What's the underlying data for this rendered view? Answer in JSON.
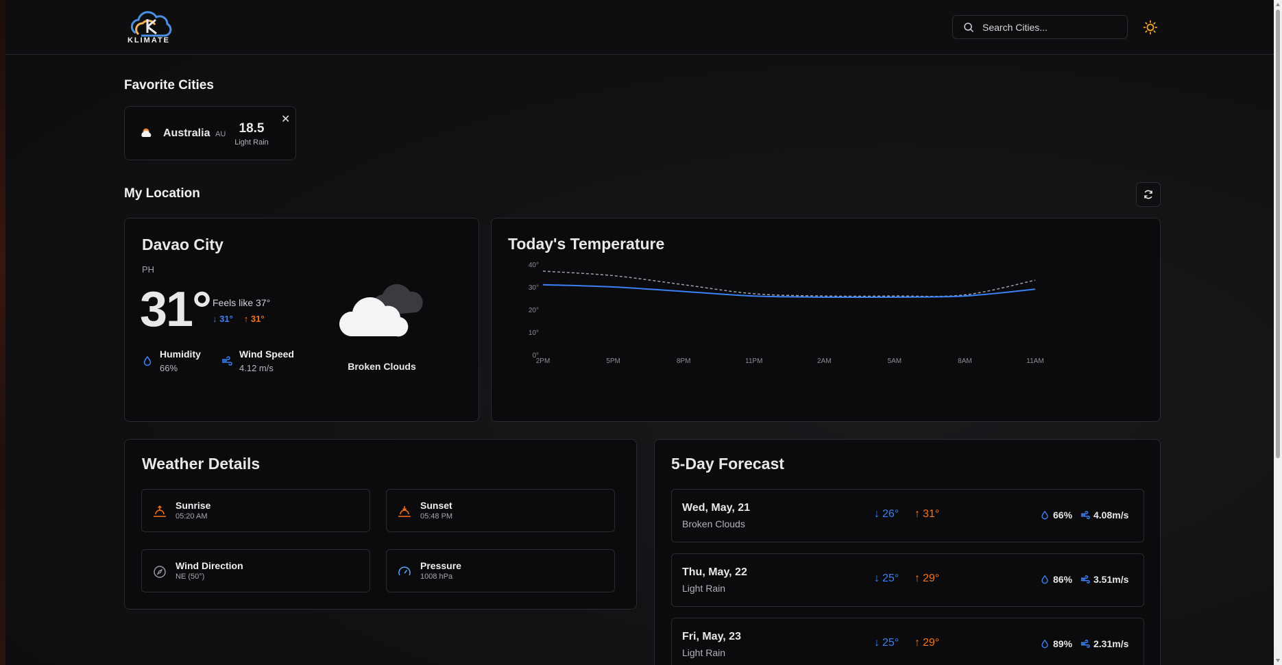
{
  "header": {
    "logo_text": "KLIMATE",
    "search_placeholder": "Search Cities..."
  },
  "favorites": {
    "title": "Favorite Cities",
    "items": [
      {
        "city": "Australia",
        "country": "AU",
        "temp": "18.5",
        "desc": "Light Rain"
      }
    ]
  },
  "location": {
    "title": "My Location",
    "city": "Davao City",
    "country": "PH",
    "temp": "31°",
    "feels_like": "Feels like 37°",
    "low": "31°",
    "high": "31°",
    "humidity_label": "Humidity",
    "humidity_value": "66%",
    "wind_label": "Wind Speed",
    "wind_value": "4.12 m/s",
    "condition": "Broken Clouds"
  },
  "chart_data": {
    "type": "line",
    "title": "Today's Temperature",
    "x": [
      "2PM",
      "5PM",
      "8PM",
      "11PM",
      "2AM",
      "5AM",
      "8AM",
      "11AM"
    ],
    "ylim": [
      0,
      40
    ],
    "yticks": [
      "0°",
      "10°",
      "20°",
      "30°",
      "40°"
    ],
    "series": [
      {
        "values": [
          31,
          30,
          28,
          26,
          25.5,
          25.5,
          26,
          29
        ],
        "color": "#3b82f6",
        "style": "solid"
      },
      {
        "values": [
          37,
          35,
          31,
          27,
          26,
          26,
          26.5,
          33
        ],
        "color": "#9ca3af",
        "style": "dashed"
      }
    ],
    "grid": false
  },
  "details": {
    "title": "Weather Details",
    "items": [
      {
        "label": "Sunrise",
        "value": "05:20 AM",
        "icon": "sunrise-icon"
      },
      {
        "label": "Sunset",
        "value": "05:48 PM",
        "icon": "sunset-icon"
      },
      {
        "label": "Wind Direction",
        "value": "NE (50°)",
        "icon": "compass-icon"
      },
      {
        "label": "Pressure",
        "value": "1008 hPa",
        "icon": "gauge-icon"
      }
    ]
  },
  "forecast": {
    "title": "5-Day Forecast",
    "days": [
      {
        "date": "Wed, May, 21",
        "desc": "Broken Clouds",
        "low": "26°",
        "high": "31°",
        "humidity": "66%",
        "wind": "4.08m/s"
      },
      {
        "date": "Thu, May, 22",
        "desc": "Light Rain",
        "low": "25°",
        "high": "29°",
        "humidity": "86%",
        "wind": "3.51m/s"
      },
      {
        "date": "Fri, May, 23",
        "desc": "Light Rain",
        "low": "25°",
        "high": "29°",
        "humidity": "89%",
        "wind": "2.31m/s"
      }
    ]
  },
  "colors": {
    "low": "#3b82f6",
    "high": "#f97316",
    "accent_sun": "#f5a623"
  }
}
